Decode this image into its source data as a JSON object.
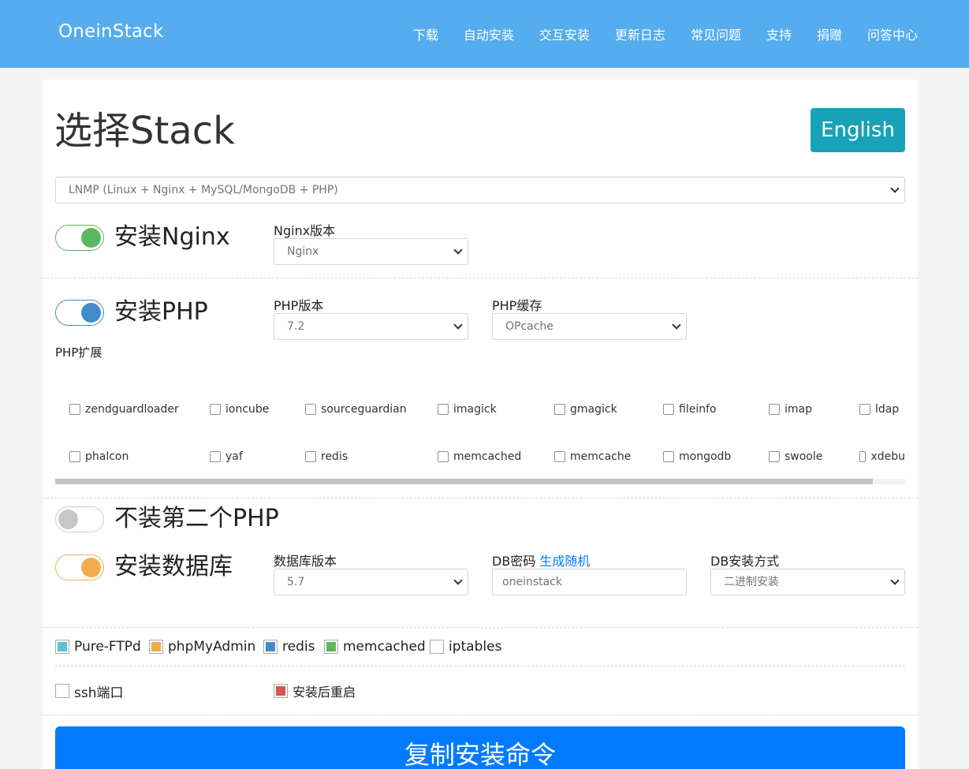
{
  "brand": "OneinStack",
  "nav": [
    "下载",
    "自动安装",
    "交互安装",
    "更新日志",
    "常见问题",
    "支持",
    "捐赠",
    "问答中心"
  ],
  "title": "选择Stack",
  "english_button": "English",
  "stack_select": "LNMP (Linux + Nginx + MySQL/MongoDB + PHP)",
  "nginx": {
    "toggle_label": "安装Nginx",
    "version_label": "Nginx版本",
    "version_value": "Nginx",
    "color": "#5cb85c"
  },
  "php": {
    "toggle_label": "安装PHP",
    "version_label": "PHP版本",
    "version_value": "7.2",
    "cache_label": "PHP缓存",
    "cache_value": "OPcache",
    "color": "#428bca",
    "ext_label": "PHP扩展",
    "extensions_row1": [
      "zendguardloader",
      "ioncube",
      "sourceguardian",
      "imagick",
      "gmagick",
      "fileinfo",
      "imap",
      "ldap"
    ],
    "extensions_row2": [
      "phalcon",
      "yaf",
      "redis",
      "memcached",
      "memcache",
      "mongodb",
      "swoole",
      "xdebu"
    ],
    "scroll_fraction": 0.962
  },
  "php2": {
    "toggle_label": "不装第二个PHP"
  },
  "db": {
    "toggle_label": "安装数据库",
    "version_label": "数据库版本",
    "version_value": "5.7",
    "pwd_label": "DB密码",
    "pwd_link": "生成随机",
    "pwd_value": "oneinstack",
    "method_label": "DB安装方式",
    "method_value": "二进制安装",
    "color": "#f0ad4e"
  },
  "options": [
    {
      "label": "Pure-FTPd",
      "color": "#5bc0de"
    },
    {
      "label": "phpMyAdmin",
      "color": "#f0ad4e"
    },
    {
      "label": "redis",
      "color": "#428bca"
    },
    {
      "label": "memcached",
      "color": "#5cb85c"
    },
    {
      "label": "iptables",
      "color": ""
    }
  ],
  "ssh_label": "ssh端口",
  "reboot_label": "安装后重启",
  "reboot_color": "#d9534f",
  "copy_button": "复制安装命令"
}
